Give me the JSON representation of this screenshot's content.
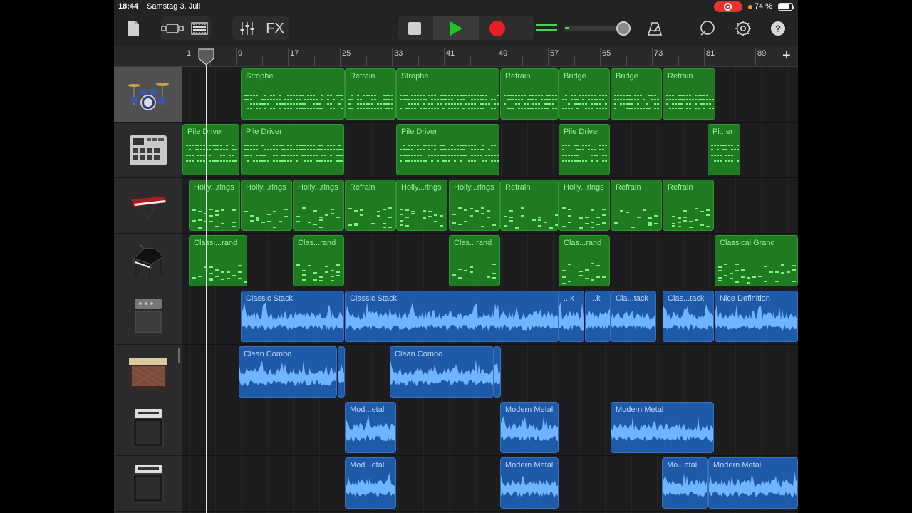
{
  "status": {
    "time": "18:44",
    "date": "Samstag 3. Juli",
    "battery": "74 %",
    "battery_level": 0.74
  },
  "toolbar": {
    "fx_label": "FX",
    "buttons": [
      "my-songs",
      "browser",
      "tracks-view",
      "mixer",
      "fx",
      "stop",
      "play",
      "record",
      "metronome",
      "loops",
      "settings",
      "help"
    ]
  },
  "ruler": {
    "bars": [
      "1",
      "9",
      "17",
      "25",
      "33",
      "41",
      "49",
      "57",
      "65",
      "73",
      "81",
      "89"
    ]
  },
  "add_track_label": "+",
  "tracks": [
    {
      "instrument": "drum-kit-icon",
      "regions": [
        {
          "name": "Strophe",
          "type": "midi"
        },
        {
          "name": "Refrain",
          "type": "midi"
        },
        {
          "name": "Strophe",
          "type": "midi"
        },
        {
          "name": "Refrain",
          "type": "midi"
        },
        {
          "name": "Bridge",
          "type": "midi"
        },
        {
          "name": "Bridge",
          "type": "midi"
        },
        {
          "name": "Refrain",
          "type": "midi"
        }
      ]
    },
    {
      "instrument": "beat-sequencer-icon",
      "regions": [
        {
          "name": "Pile Driver",
          "type": "midi"
        },
        {
          "name": "Pile Driver",
          "type": "midi"
        },
        {
          "name": "Pile Driver",
          "type": "midi"
        },
        {
          "name": "Pile Driver",
          "type": "midi"
        },
        {
          "name": "Pi...er",
          "type": "midi"
        }
      ]
    },
    {
      "instrument": "keyboard-icon",
      "regions": [
        {
          "name": "Holly...rings",
          "type": "midi"
        },
        {
          "name": "Holly...rings",
          "type": "midi"
        },
        {
          "name": "Holly...rings",
          "type": "midi"
        },
        {
          "name": "Refrain",
          "type": "midi"
        },
        {
          "name": "Holly...rings",
          "type": "midi"
        },
        {
          "name": "Holly...rings",
          "type": "midi"
        },
        {
          "name": "Refrain",
          "type": "midi"
        },
        {
          "name": "Holly...rings",
          "type": "midi"
        },
        {
          "name": "Refrain",
          "type": "midi"
        },
        {
          "name": "Refrain",
          "type": "midi"
        }
      ]
    },
    {
      "instrument": "grand-piano-icon",
      "regions": [
        {
          "name": "Classi...rand",
          "type": "midi"
        },
        {
          "name": "Clas...rand",
          "type": "midi"
        },
        {
          "name": "Clas...rand",
          "type": "midi"
        },
        {
          "name": "Clas...rand",
          "type": "midi"
        },
        {
          "name": "Classical Grand",
          "type": "midi"
        }
      ]
    },
    {
      "instrument": "guitar-amp-icon",
      "regions": [
        {
          "name": "Classic Stack",
          "type": "audio"
        },
        {
          "name": "Classic Stack",
          "type": "audio"
        },
        {
          "name": "...k",
          "type": "audio"
        },
        {
          "name": "...k",
          "type": "audio"
        },
        {
          "name": "Cla...tack",
          "type": "audio"
        },
        {
          "name": "Clas...tack",
          "type": "audio"
        },
        {
          "name": "Nice Definition",
          "type": "audio"
        }
      ]
    },
    {
      "instrument": "combo-amp-icon",
      "regions": [
        {
          "name": "Clean Combo",
          "type": "audio"
        },
        {
          "name": "",
          "type": "audio"
        },
        {
          "name": "Clean Combo",
          "type": "audio"
        },
        {
          "name": "",
          "type": "audio"
        }
      ]
    },
    {
      "instrument": "metal-amp-icon",
      "regions": [
        {
          "name": "Mod...etal",
          "type": "audio"
        },
        {
          "name": "Modern Metal",
          "type": "audio"
        },
        {
          "name": "Modern Metal",
          "type": "audio"
        }
      ]
    },
    {
      "instrument": "metal-amp-icon",
      "regions": [
        {
          "name": "Mod...etal",
          "type": "audio"
        },
        {
          "name": "Modern Metal",
          "type": "audio"
        },
        {
          "name": "Mo...etal",
          "type": "audio"
        },
        {
          "name": "Modern Metal",
          "type": "audio"
        }
      ]
    }
  ],
  "colors": {
    "midi_region": "#1f7a22",
    "midi_text": "#8ff58c",
    "audio_region": "#1f5aa8",
    "audio_text": "#b8d6ff",
    "play": "#22c322",
    "record": "#e81e25"
  }
}
